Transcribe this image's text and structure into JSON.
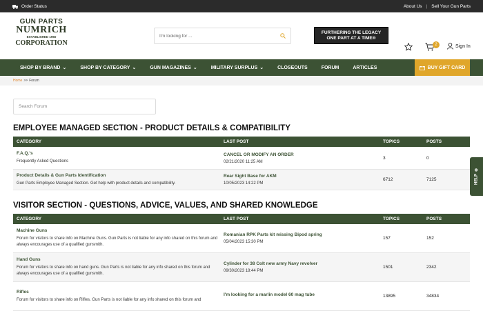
{
  "topbar": {
    "order_status": "Order Status",
    "about": "About Us",
    "separator": "|",
    "sell": "Sell Your Gun Parts"
  },
  "logo": {
    "line1": "GUN PARTS",
    "line2": "NUMRICH",
    "line3": "ESTABLISHED 1950",
    "line4": "CORPORATION"
  },
  "search": {
    "placeholder": "I'm looking for ..."
  },
  "promo": {
    "line1": "FURTHERING THE LEGACY",
    "line2": "ONE PART AT A TIME®"
  },
  "cart": {
    "count": "2"
  },
  "account": {
    "signin": "Sign In"
  },
  "nav": {
    "items": [
      {
        "label": "SHOP BY BRAND",
        "dropdown": true
      },
      {
        "label": "SHOP BY CATEGORY",
        "dropdown": true
      },
      {
        "label": "GUN MAGAZINES",
        "dropdown": true
      },
      {
        "label": "MILITARY SURPLUS",
        "dropdown": true
      },
      {
        "label": "CLOSEOUTS",
        "dropdown": false
      },
      {
        "label": "FORUM",
        "dropdown": false
      },
      {
        "label": "ARTICLES",
        "dropdown": false
      }
    ],
    "gift": "BUY GIFT CARD"
  },
  "breadcrumb": {
    "home": "Home",
    "sep": ">>",
    "current": "Forum"
  },
  "forum_search": {
    "placeholder": "Search Forum"
  },
  "columns": {
    "category": "CATEGORY",
    "last_post": "LAST POST",
    "topics": "TOPICS",
    "posts": "POSTS"
  },
  "sections": [
    {
      "title": "EMPLOYEE MANAGED SECTION - PRODUCT DETAILS & COMPATIBILITY",
      "rows": [
        {
          "name": "F.A.Q.'s",
          "desc": "Frequently Asked Questions",
          "post_title": "CANCEL OR MODIFY AN ORDER",
          "post_date": "02/21/2020 11:25 AM",
          "topics": "3",
          "posts": "0"
        },
        {
          "name": "Product Details & Gun Parts Identification",
          "desc": "Gun Parts Employee Managed Section. Get help with product details and compatibility.",
          "post_title": "Rear Sight Base for AKM",
          "post_date": "10/05/2023 14:22 PM",
          "topics": "6712",
          "posts": "7125"
        }
      ]
    },
    {
      "title": "VISITOR SECTION - QUESTIONS, ADVICE, VALUES, AND SHARED KNOWLEDGE",
      "rows": [
        {
          "name": "Machine Guns",
          "desc": "Forum for visitors to share info on Machine Guns. Gun Parts is not liable for any info shared on this forum and always encourages use of a qualified gunsmith.",
          "post_title": "Romanian RPK Parts kit missing Bipod spring",
          "post_date": "05/04/2023 15:30 PM",
          "topics": "157",
          "posts": "152"
        },
        {
          "name": "Hand Guns",
          "desc": "Forum for visitors to share info on hand guns. Gun Parts is not liable for any info shared on this forum and always encourages use of a qualified gunsmith.",
          "post_title": "Cylinder for 38 Colt new army Navy revolver",
          "post_date": "09/30/2023 18:44 PM",
          "topics": "1501",
          "posts": "2342"
        },
        {
          "name": "Rifles",
          "desc": "Forum for visitors to share info on Rifles. Gun Parts is not liable for any info shared on this forum and",
          "post_title": "I'm looking for a marlin model 60 mag tube",
          "post_date": "",
          "topics": "13895",
          "posts": "34834"
        }
      ]
    }
  ],
  "help": {
    "label": "HELP"
  }
}
